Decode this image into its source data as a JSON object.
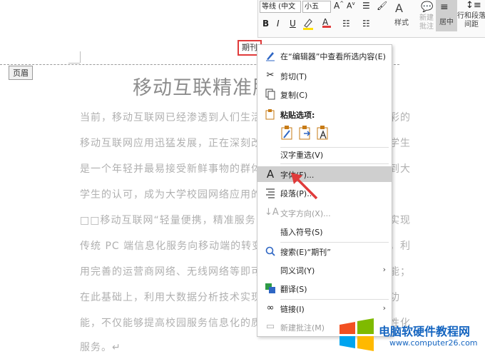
{
  "toolbar": {
    "font_name": "等线 (中文",
    "font_size": "小五",
    "styles_label": "样式",
    "new_comment_label": "新建\n批注",
    "center_label": "居中",
    "line_spacing_label": "行和段落\n间距"
  },
  "header": {
    "tag_label": "页眉",
    "text": "期刊"
  },
  "document": {
    "title": "移动互联精准服",
    "lines_left": [
      "当前，移动互联网已经渗透到人们生活、生",
      "移动互联网应用迅猛发展，正在深刻改变",
      "是一个年轻并最易接受新鲜事物的群体，",
      "学生的认可，成为大学校园网络应用的一",
      "□□移动互联网“轻量便携，精准服务”",
      "传统 PC 端信息化服务向移动端的转变，",
      "用完善的运营商网络、无线网络等即可访",
      "在此基础上，利用大数据分析技术实现个",
      "能，不仅能够提高校园服务信息化的质量",
      "服务。↵"
    ],
    "lines_right": [
      "彩的",
      "学生",
      "到大",
      "",
      "实现",
      "，利",
      "能；",
      "功",
      "性化"
    ]
  },
  "context_menu": {
    "items": [
      {
        "label": "在“编辑器”中查看所选内容(E)",
        "icon": "pen-icon",
        "disabled": false
      },
      {
        "label": "剪切(T)",
        "icon": "scissors-icon",
        "disabled": false
      },
      {
        "label": "复制(C)",
        "icon": "copy-icon",
        "disabled": false
      },
      {
        "label": "粘贴选项:",
        "icon": "clipboard-icon",
        "disabled": false
      },
      {
        "label": "汉字重选(V)",
        "icon": "",
        "disabled": false
      },
      {
        "label": "字体(F)...",
        "icon": "font-a-icon",
        "disabled": false
      },
      {
        "label": "段落(P)...",
        "icon": "paragraph-icon",
        "disabled": false
      },
      {
        "label": "文字方向(X)...",
        "icon": "text-direction-icon",
        "disabled": true
      },
      {
        "label": "插入符号(S)",
        "icon": "",
        "disabled": false
      },
      {
        "label": "搜索(E)“期刊”",
        "icon": "search-icon",
        "disabled": false
      },
      {
        "label": "同义词(Y)",
        "icon": "",
        "disabled": false
      },
      {
        "label": "翻译(S)",
        "icon": "translate-icon",
        "disabled": false
      },
      {
        "label": "链接(I)",
        "icon": "link-icon",
        "disabled": false
      },
      {
        "label": "新建批注(M)",
        "icon": "comment-icon",
        "disabled": true
      }
    ]
  },
  "watermark": {
    "title": "电脑软硬件教程网",
    "url": "www.computer26.com"
  },
  "colors": {
    "highlight_red": "#e03b3b",
    "menu_hover": "#cfcfcf",
    "brand_blue": "#1565c0"
  }
}
